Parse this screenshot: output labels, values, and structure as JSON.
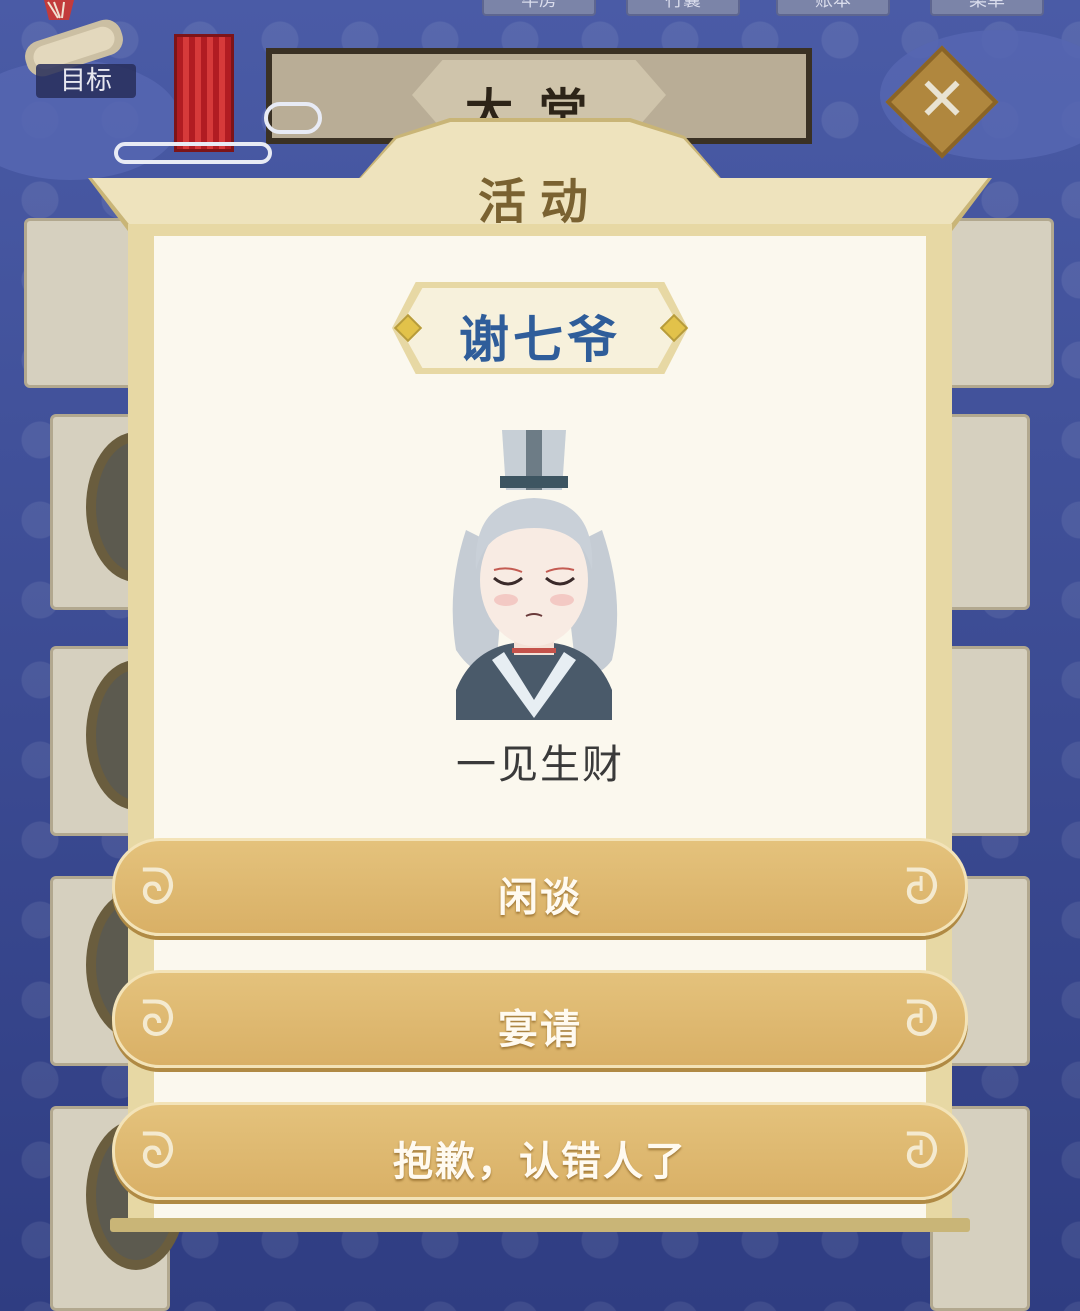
{
  "header": {
    "goal_label": "目标",
    "title": "大堂",
    "top_tabs": [
      "牢房",
      "行囊",
      "账本",
      "菜单"
    ]
  },
  "modal": {
    "title": "活动",
    "character_name": "谢七爷",
    "status_text": "一见生财",
    "options": [
      {
        "label": "闲谈"
      },
      {
        "label": "宴请"
      },
      {
        "label": "抱歉，认错人了"
      }
    ]
  },
  "colors": {
    "background": "#3b4a8e",
    "modal_frame": "#e7d8a4",
    "modal_paper": "#fbf8ee",
    "name_blue": "#2f5d9a",
    "button_gold": "#d9b066",
    "title_brown": "#7a6231"
  },
  "icons": {
    "goal": "scroll-fan-icon",
    "close": "close-icon",
    "door": "red-door-icon",
    "button_ornament": "cloud-swirl-icon"
  }
}
